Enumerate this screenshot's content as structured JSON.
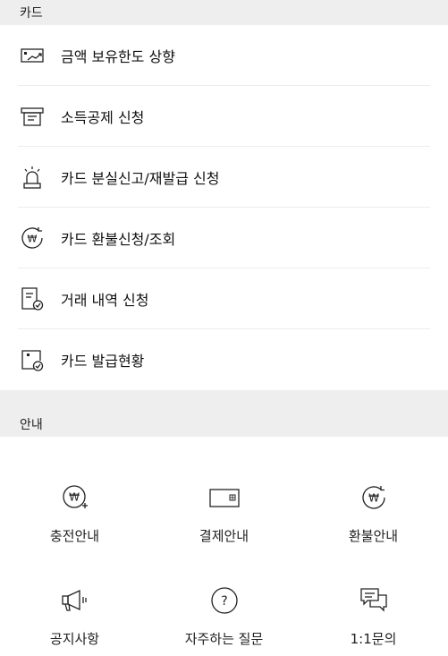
{
  "card_section": {
    "title": "카드",
    "items": [
      {
        "label": "금액 보유한도 상향",
        "icon": "limit-up-icon"
      },
      {
        "label": "소득공제 신청",
        "icon": "tax-deduction-icon"
      },
      {
        "label": "카드 분실신고/재발급 신청",
        "icon": "alarm-icon"
      },
      {
        "label": "카드 환불신청/조회",
        "icon": "won-refresh-icon"
      },
      {
        "label": "거래 내역 신청",
        "icon": "document-check-icon"
      },
      {
        "label": "카드 발급현황",
        "icon": "card-check-icon"
      }
    ]
  },
  "info_section": {
    "title": "안내",
    "items": [
      {
        "label": "충전안내",
        "icon": "won-plus-icon"
      },
      {
        "label": "결제안내",
        "icon": "card-icon"
      },
      {
        "label": "환불안내",
        "icon": "won-refresh-icon"
      },
      {
        "label": "공지사항",
        "icon": "megaphone-icon"
      },
      {
        "label": "자주하는 질문",
        "icon": "question-icon"
      },
      {
        "label": "1:1문의",
        "icon": "chat-icon"
      }
    ]
  }
}
